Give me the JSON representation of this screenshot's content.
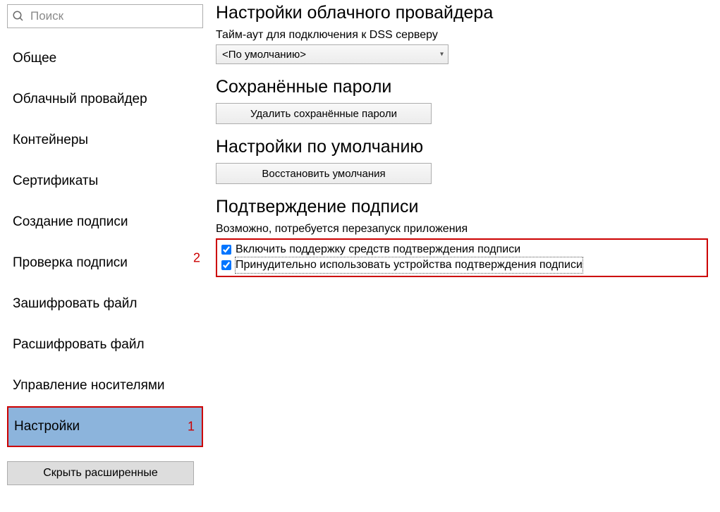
{
  "search": {
    "placeholder": "Поиск"
  },
  "sidebar": {
    "items": [
      {
        "label": "Общее"
      },
      {
        "label": "Облачный провайдер"
      },
      {
        "label": "Контейнеры"
      },
      {
        "label": "Сертификаты"
      },
      {
        "label": "Создание подписи"
      },
      {
        "label": "Проверка подписи"
      },
      {
        "label": "Зашифровать файл"
      },
      {
        "label": "Расшифровать файл"
      },
      {
        "label": "Управление носителями"
      },
      {
        "label": "Настройки"
      }
    ],
    "hide_advanced": "Скрыть расширенные"
  },
  "annotations": {
    "a1": "1",
    "a2": "2"
  },
  "settings": {
    "cloud_provider_heading": "Настройки облачного провайдера",
    "timeout_label": "Тайм-аут для подключения к DSS серверу",
    "timeout_value": "<По умолчанию>",
    "saved_passwords_heading": "Сохранённые пароли",
    "delete_passwords_button": "Удалить сохранённые пароли",
    "defaults_heading": "Настройки по умолчанию",
    "restore_defaults_button": "Восстановить умолчания",
    "confirm_heading": "Подтверждение подписи",
    "confirm_hint": "Возможно, потребуется перезапуск приложения",
    "cb_enable_support": "Включить поддержку средств подтверждения подписи",
    "cb_force_device": "Принудительно использовать устройства подтверждения подписи"
  }
}
